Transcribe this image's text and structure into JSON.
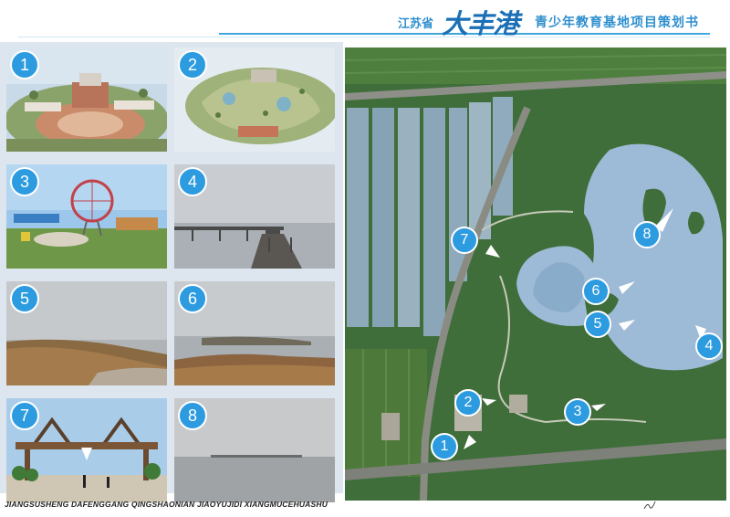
{
  "header": {
    "province": "江苏省",
    "brand": "大丰港",
    "title": "青少年教育基地项目策划书"
  },
  "footer": {
    "pinyin": "JIANGSUSHENG DAFENGGANG QINGSHAONIAN JIAOYUJIDI XIANGMUCEHUASHU"
  },
  "photos": [
    {
      "number": "1"
    },
    {
      "number": "2"
    },
    {
      "number": "3"
    },
    {
      "number": "4"
    },
    {
      "number": "5"
    },
    {
      "number": "6"
    },
    {
      "number": "7"
    },
    {
      "number": "8"
    }
  ],
  "map": {
    "markers": [
      {
        "number": "1"
      },
      {
        "number": "2"
      },
      {
        "number": "3"
      },
      {
        "number": "4"
      },
      {
        "number": "5"
      },
      {
        "number": "6"
      },
      {
        "number": "7"
      },
      {
        "number": "8"
      }
    ]
  },
  "colors": {
    "accent": "#2d9be0",
    "header_text": "#2f8fcf",
    "brand_text": "#1a6fb6",
    "panel_bg": "#dde6ee"
  }
}
